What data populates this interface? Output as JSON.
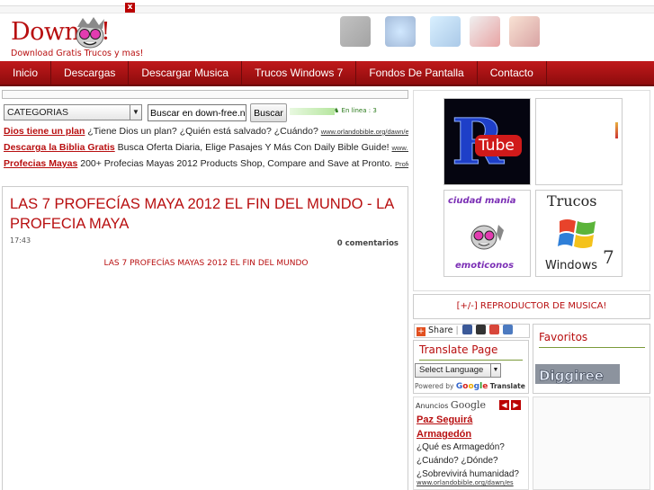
{
  "header": {
    "logo_text": "Down       e!",
    "tagline": "Download Gratis Trucos y mas!",
    "close_label": "x"
  },
  "nav": {
    "items": [
      "Inicio",
      "Descargas",
      "Descargar Musica",
      "Trucos Windows 7",
      "Fondos De Pantalla",
      "Contacto"
    ]
  },
  "search": {
    "category_value": "CATEGORIAS",
    "input_value": "Buscar en down-free.net",
    "button_label": "Buscar",
    "online_text": "En linea : 3"
  },
  "ads": [
    {
      "title": "Dios tiene un plan",
      "text": " ¿Tiene Dios un plan? ¿Quién está salvado? ¿Cuándo? ",
      "url": "www.orlandobible.org/dawn/es"
    },
    {
      "title": "Descarga la Biblia Gratis",
      "text": " Busca Oferta Diaria, Elige Pasajes Y Más Con Daily Bible Guide! ",
      "url": "www.DailyBibleGu"
    },
    {
      "title": "Profecias Mayas",
      "text": " 200+ Profecias Mayas 2012 Products Shop, Compare and Save at Pronto. ",
      "url": "Profecias.Pronto"
    }
  ],
  "post": {
    "title": "LAS 7 PROFECÍAS MAYA 2012 EL FIN DEL MUNDO - LA PROFECIA MAYA",
    "time": "17:43",
    "comments": "0 comentarios",
    "subtitle": "LAS 7 PROFECÍAS MAYAS 2012 EL FIN DEL MUNDO"
  },
  "thumbs": {
    "rtube_text": "Tube",
    "ciudad_text": "ciudad mania",
    "emoticonos_text": "emoticonos",
    "trucos_top": "Trucos",
    "trucos_bottom": "Windows",
    "trucos_num": "7"
  },
  "reproductor": "[+/-] REPRODUCTOR DE MUSICA!",
  "share": {
    "label": "Share"
  },
  "translate": {
    "title": "Translate Page",
    "select_value": "Select Language",
    "powered_by": "Powered by",
    "google": "Google",
    "translate_word": "Translate"
  },
  "favoritos": {
    "title": "Favoritos",
    "logo_text": "Diggiree"
  },
  "google_ad": {
    "label": "Anuncios",
    "google": "Google",
    "title": "Paz Seguirá Armagedón",
    "text": "¿Qué es Armagedón? ¿Cuándo? ¿Dónde? ¿Sobrevivirá humanidad?",
    "url": "www.orlandobible.org/dawn/es",
    "prev": "◀",
    "next": "▶"
  },
  "colors": {
    "brand_red": "#b80f10",
    "nav_top": "#c0191b",
    "nav_bottom": "#8e0c0d"
  }
}
